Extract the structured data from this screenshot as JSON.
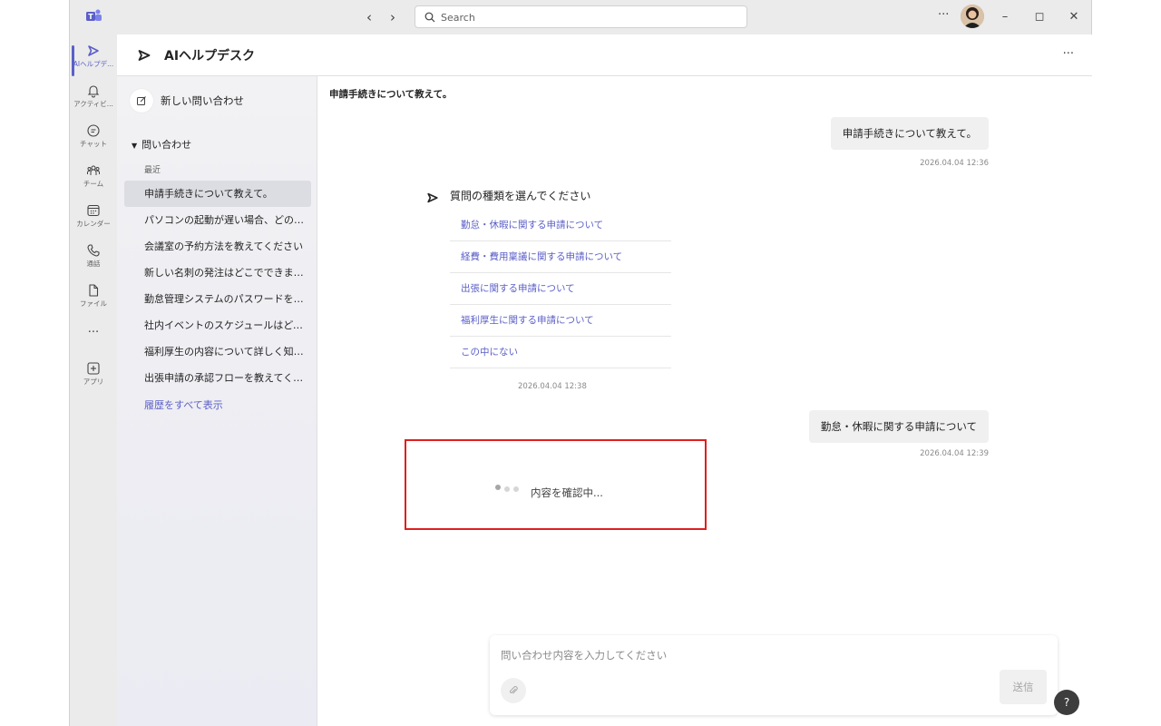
{
  "titlebar": {
    "search_placeholder": "Search",
    "back_glyph": "‹",
    "forward_glyph": "›",
    "more_glyph": "···",
    "minimize_glyph": "–",
    "maximize_glyph": "◻",
    "close_glyph": "✕"
  },
  "rail": {
    "items": [
      {
        "label": "AIヘルプデ...",
        "icon": "play-triangle-icon",
        "active": true
      },
      {
        "label": "アクティビ...",
        "icon": "bell-icon"
      },
      {
        "label": "チャット",
        "icon": "chat-icon"
      },
      {
        "label": "チーム",
        "icon": "teams-icon"
      },
      {
        "label": "カレンダー",
        "icon": "calendar-icon"
      },
      {
        "label": "通話",
        "icon": "phone-icon"
      },
      {
        "label": "ファイル",
        "icon": "file-icon"
      },
      {
        "label": "",
        "icon": "more-icon",
        "glyph": "···"
      },
      {
        "label": "アプリ",
        "icon": "add-app-icon"
      }
    ]
  },
  "header": {
    "title": "AIヘルプデスク",
    "more_glyph": "···"
  },
  "sidebar": {
    "new_inquiry": "新しい問い合わせ",
    "section_title": "問い合わせ",
    "section_toggle": "▼",
    "recent_label": "最近",
    "history": [
      "申請手続きについて教えて。",
      "パソコンの起動が遅い場合、どのように対処すればいいですか",
      "会議室の予約方法を教えてください",
      "新しい名刺の発注はどこでできますか",
      "勤怠管理システムのパスワードを忘れました",
      "社内イベントのスケジュールはどこで確認できますか",
      "福利厚生の内容について詳しく知りたいです",
      "出張申請の承認フローを教えてください"
    ],
    "show_all": "履歴をすべて表示"
  },
  "chat": {
    "title": "申請手続きについて教えて。",
    "messages": {
      "user1": {
        "text": "申請手続きについて教えて。",
        "time": "2026.04.04 12:36"
      },
      "bot1": {
        "question": "質問の種類を選んでください",
        "options": [
          "勤怠・休暇に関する申請について",
          "経費・費用稟議に関する申請について",
          "出張に関する申請について",
          "福利厚生に関する申請について",
          "この中にない"
        ],
        "time": "2026.04.04 12:38"
      },
      "user2": {
        "text": "勤怠・休暇に関する申請について",
        "time": "2026.04.04 12:39"
      }
    },
    "loading_text": "内容を確認中..."
  },
  "composer": {
    "placeholder": "問い合わせ内容を入力してください",
    "send_label": "送信"
  },
  "help": {
    "label": "?"
  },
  "colors": {
    "accent": "#5b5fc7",
    "highlight_border": "#e01e1e",
    "titlebar_bg": "#ebebeb"
  }
}
